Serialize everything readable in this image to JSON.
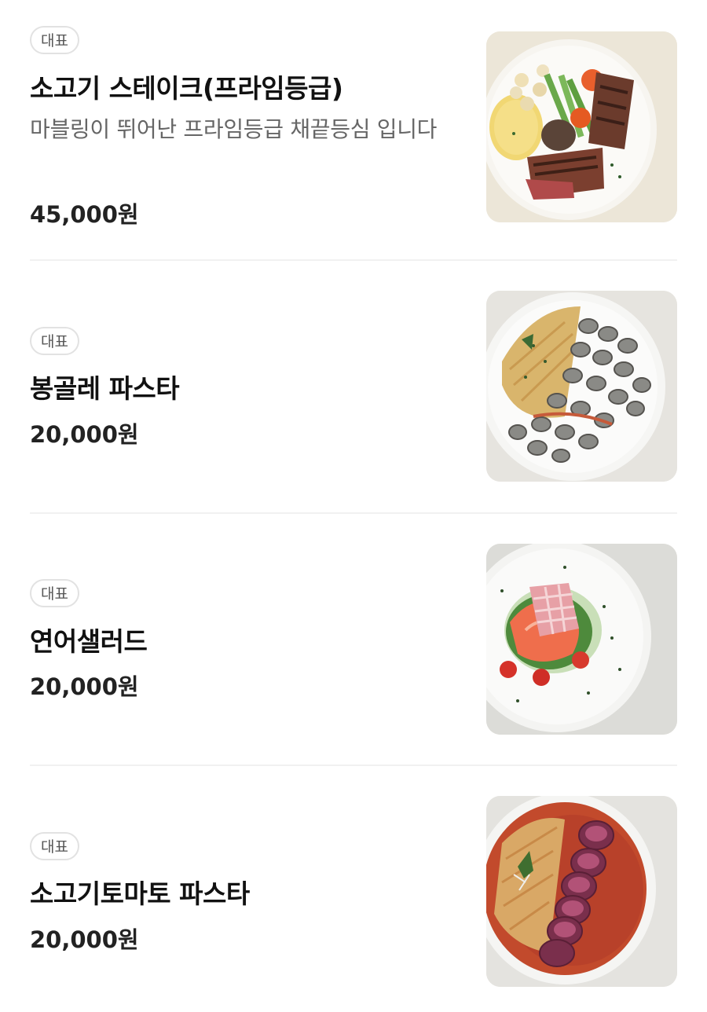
{
  "menu": {
    "items": [
      {
        "badge": "대표",
        "name": "소고기 스테이크(프라임등급)",
        "description": "마블링이 뛰어난 프라임등급 채끝등심 입니다",
        "price": "45,000원",
        "image_icon": "steak-photo"
      },
      {
        "badge": "대표",
        "name": "봉골레 파스타",
        "price": "20,000원",
        "image_icon": "vongole-pasta-photo"
      },
      {
        "badge": "대표",
        "name": "연어샐러드",
        "price": "20,000원",
        "image_icon": "salmon-salad-photo"
      },
      {
        "badge": "대표",
        "name": "소고기토마토 파스타",
        "price": "20,000원",
        "image_icon": "beef-tomato-pasta-photo"
      }
    ]
  }
}
